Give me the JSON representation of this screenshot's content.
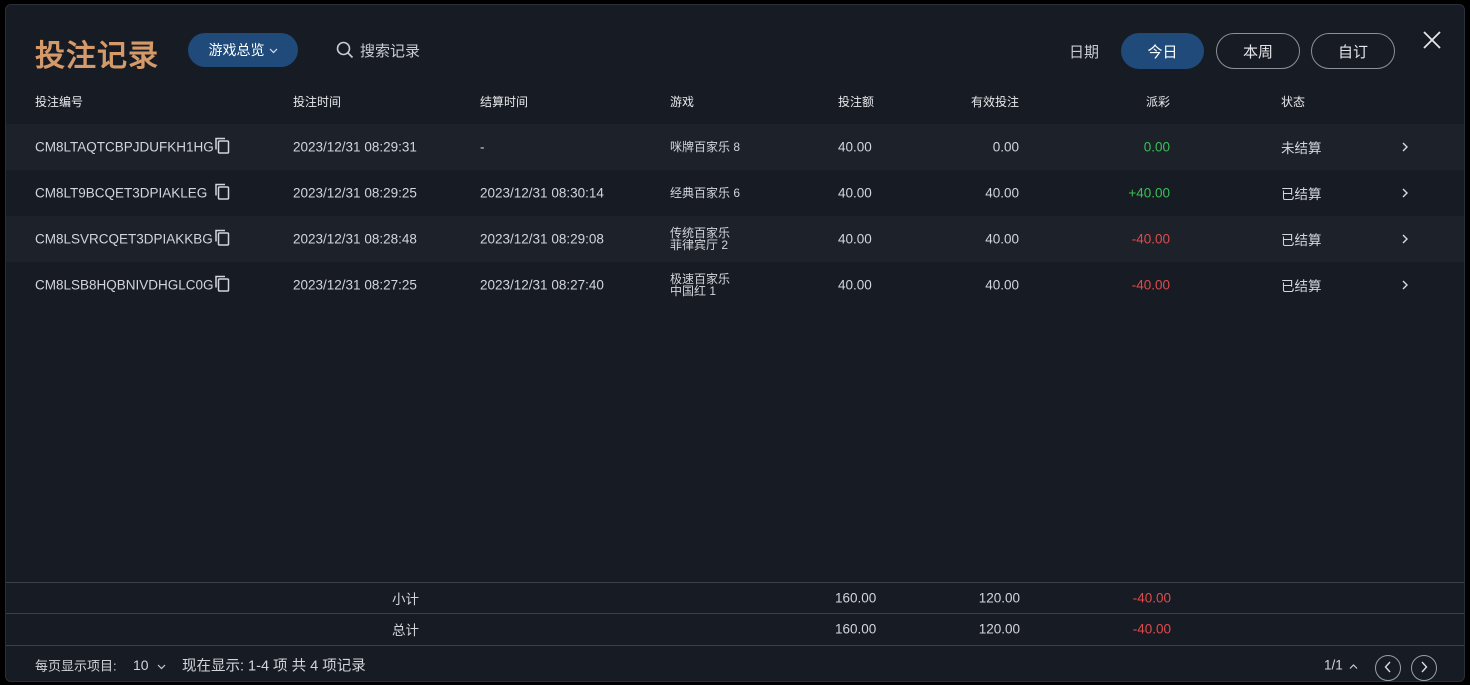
{
  "header": {
    "title": "投注记录",
    "game_select": "游戏总览",
    "search_placeholder": "搜索记录",
    "date_label": "日期",
    "periods": [
      "今日",
      "本周",
      "自订"
    ],
    "active_period": "今日"
  },
  "table": {
    "columns": [
      "投注编号",
      "投注时间",
      "结算时间",
      "游戏",
      "投注额",
      "有效投注",
      "派彩",
      "状态"
    ],
    "rows": [
      {
        "id": "CM8LTAQTCBPJDUFKH1HG",
        "bet_time": "2023/12/31 08:29:31",
        "settle_time": "-",
        "game_line1": "咪牌百家乐 8",
        "game_line2": "",
        "amount": "40.00",
        "valid": "0.00",
        "payout": "0.00",
        "payout_color": "#3bbf55",
        "status": "未结算"
      },
      {
        "id": "CM8LT9BCQET3DPIAKLEG",
        "bet_time": "2023/12/31 08:29:25",
        "settle_time": "2023/12/31 08:30:14",
        "game_line1": "经典百家乐 6",
        "game_line2": "",
        "amount": "40.00",
        "valid": "40.00",
        "payout": "+40.00",
        "payout_color": "#3bbf55",
        "status": "已结算"
      },
      {
        "id": "CM8LSVRCQET3DPIAKKBG",
        "bet_time": "2023/12/31 08:28:48",
        "settle_time": "2023/12/31 08:29:08",
        "game_line1": "传统百家乐",
        "game_line2": "菲律宾厅 2",
        "amount": "40.00",
        "valid": "40.00",
        "payout": "-40.00",
        "payout_color": "#e04b4b",
        "status": "已结算"
      },
      {
        "id": "CM8LSB8HQBNIVDHGLC0G",
        "bet_time": "2023/12/31 08:27:25",
        "settle_time": "2023/12/31 08:27:40",
        "game_line1": "极速百家乐",
        "game_line2": "中国红 1",
        "amount": "40.00",
        "valid": "40.00",
        "payout": "-40.00",
        "payout_color": "#e04b4b",
        "status": "已结算"
      }
    ]
  },
  "summary": {
    "subtotal": {
      "label": "小计",
      "amount": "160.00",
      "valid": "120.00",
      "payout": "-40.00"
    },
    "total": {
      "label": "总计",
      "amount": "160.00",
      "valid": "120.00",
      "payout": "-40.00"
    }
  },
  "footer": {
    "per_page_label": "每页显示项目:",
    "per_page_value": "10",
    "showing_text": "现在显示: 1-4 项 共 4 项记录",
    "page": "1/1"
  },
  "colors": {
    "accent_title": "#d59a6a",
    "active_pill": "#1f4a7a",
    "positive": "#3bbf55",
    "negative": "#e04b4b"
  }
}
